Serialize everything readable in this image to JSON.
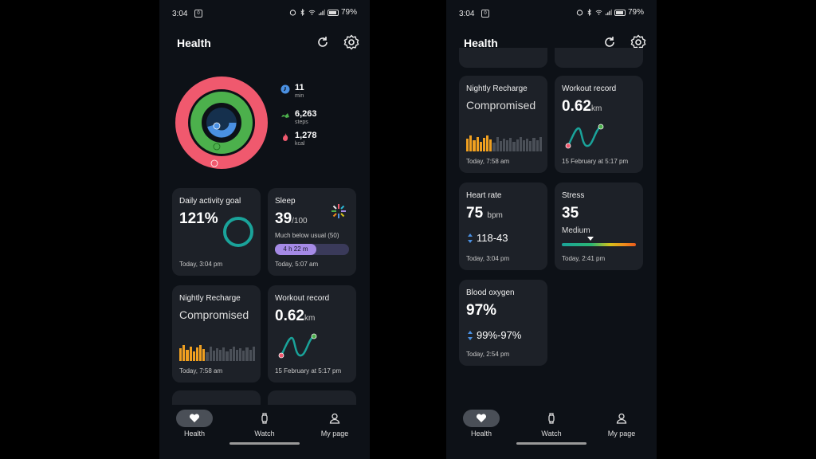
{
  "status": {
    "time": "3:04",
    "notif_badge": "0",
    "battery": "79%"
  },
  "header": {
    "title": "Health"
  },
  "activity": {
    "minutes": {
      "value": "11",
      "label": "min"
    },
    "steps": {
      "value": "6,263",
      "label": "steps"
    },
    "kcal": {
      "value": "1,278",
      "label": "kcal"
    }
  },
  "daily_goal": {
    "title": "Daily activity goal",
    "value": "121%",
    "progress_percent": 121,
    "foot": "Today, 3:04 pm"
  },
  "sleep": {
    "title": "Sleep",
    "value": "39",
    "unit": "/100",
    "note": "Much below usual (50)",
    "duration": "4 h 22 m",
    "foot": "Today, 5:07 am"
  },
  "recharge": {
    "title": "Nightly Recharge",
    "value": "Compromised",
    "foot": "Today, 7:58 am"
  },
  "workout": {
    "title": "Workout record",
    "value": "0.62",
    "unit": "km",
    "foot": "15 February at 5:17 pm"
  },
  "heart": {
    "title": "Heart rate",
    "value": "75",
    "unit": "bpm",
    "range": "118-43",
    "foot": "Today, 3:04 pm"
  },
  "stress": {
    "title": "Stress",
    "value": "35",
    "level": "Medium",
    "foot": "Today, 2:41 pm"
  },
  "oxygen": {
    "title": "Blood oxygen",
    "value": "97%",
    "range": "99%-97%",
    "foot": "Today, 2:54 pm"
  },
  "nav": {
    "health": "Health",
    "watch": "Watch",
    "mypage": "My page"
  },
  "colors": {
    "move_ring": "#f0596e",
    "exercise_ring": "#4cb04c",
    "inner_ring": "#4a90e2",
    "goal_ring": "#1aa39a",
    "card_bg": "#1d2128",
    "accent_sleep": "#a58ae6"
  },
  "icons": [
    "refresh-icon",
    "gear-icon",
    "heart-icon",
    "watch-icon",
    "person-icon",
    "flame-icon",
    "steps-icon",
    "clock-icon"
  ]
}
